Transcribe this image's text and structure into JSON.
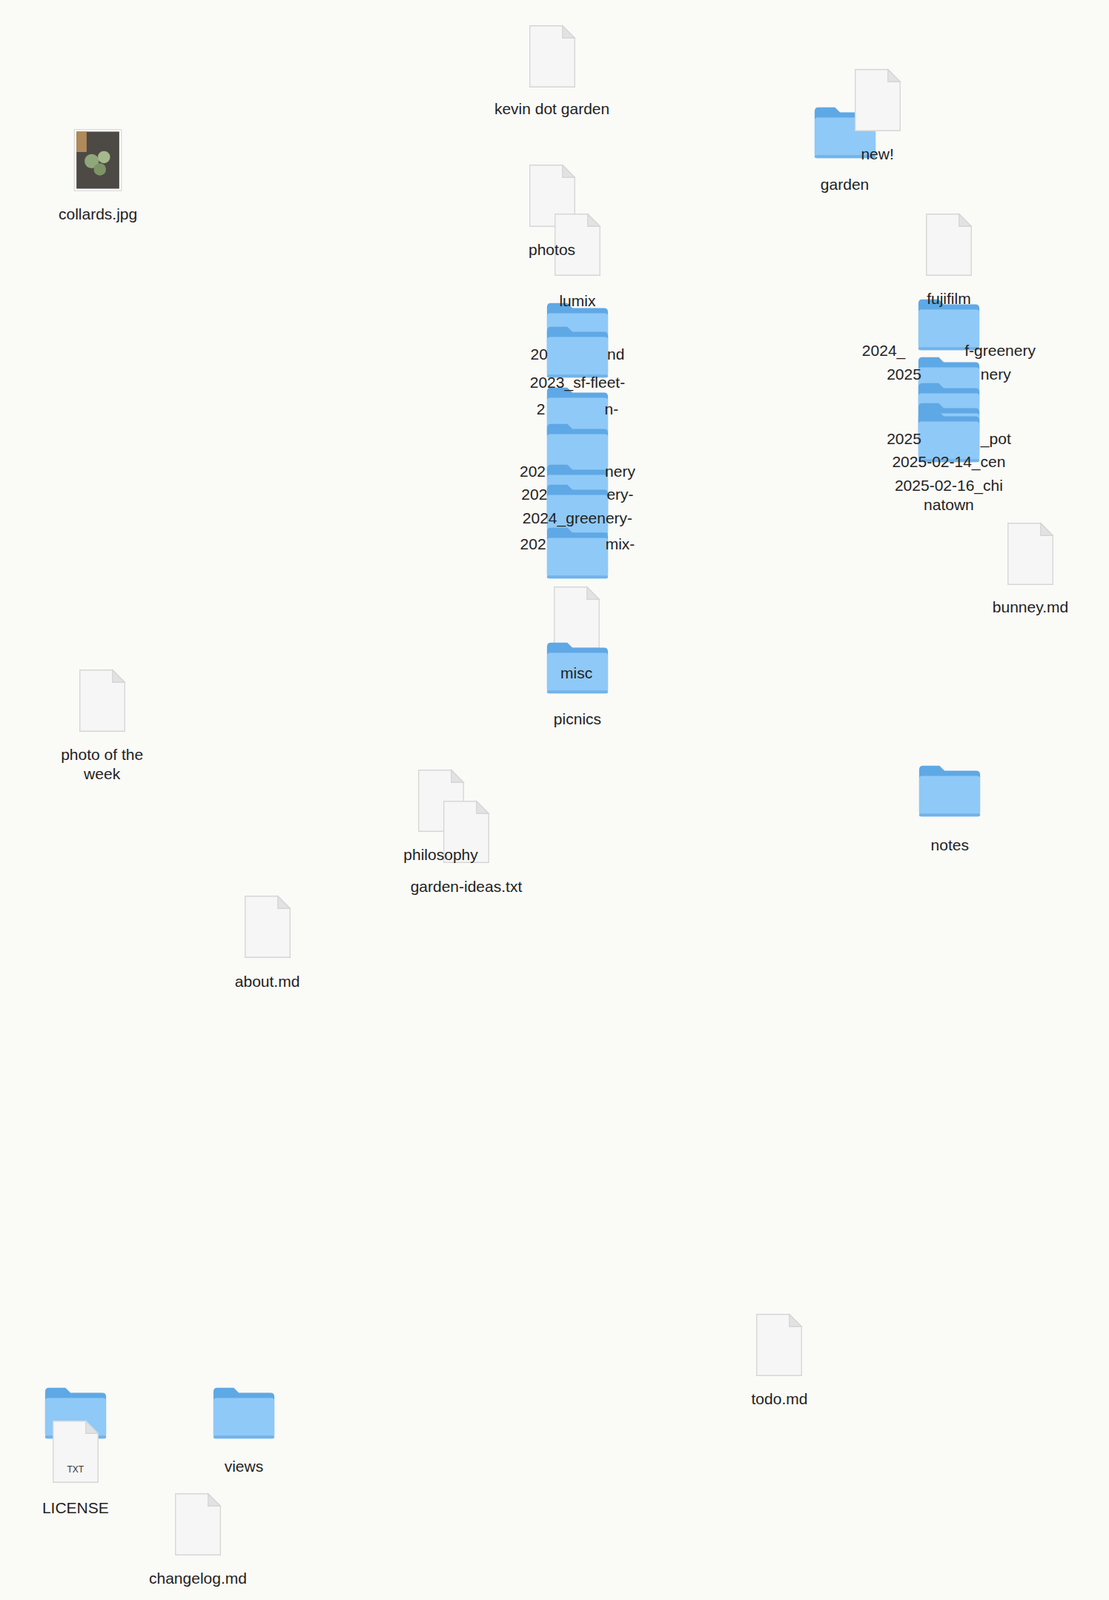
{
  "desktop": {
    "items": [
      {
        "kind": "file",
        "lines": [
          "kevin dot garden"
        ]
      },
      {
        "kind": "image",
        "lines": [
          "collards.jpg"
        ]
      },
      {
        "kind": "folder",
        "lines": [
          "garden"
        ]
      },
      {
        "kind": "file",
        "lines": [
          "new!"
        ]
      },
      {
        "kind": "file",
        "lines": [
          "photos"
        ]
      },
      {
        "kind": "file",
        "lines": [
          "lumix"
        ]
      },
      {
        "kind": "folder",
        "lines": [
          "20"
        ],
        "tail": "nd"
      },
      {
        "kind": "folder",
        "lines": [
          "2023_sf-fleet-"
        ]
      },
      {
        "kind": "folder",
        "lines": [
          "2"
        ],
        "tail": "n-"
      },
      {
        "kind": "folder",
        "lines": [
          "202"
        ],
        "tail": "nery"
      },
      {
        "kind": "folder",
        "lines": [
          "202"
        ],
        "tail": "ery-"
      },
      {
        "kind": "folder",
        "lines": [
          "2024_greenery-"
        ]
      },
      {
        "kind": "folder",
        "lines": [
          "202"
        ],
        "tail": "mix-"
      },
      {
        "kind": "file",
        "lines": [
          "fujifilm"
        ]
      },
      {
        "kind": "folder",
        "lines": [
          "2024_"
        ],
        "tail": "f-greenery"
      },
      {
        "kind": "folder",
        "lines": [
          "2025"
        ],
        "tail": "nery"
      },
      {
        "kind": "folder",
        "lines": [
          "2025"
        ],
        "tail": "_pot"
      },
      {
        "kind": "folder",
        "lines": [
          "2025-02-14_cen"
        ]
      },
      {
        "kind": "folder",
        "lines": [
          "2025-02-16_chi",
          "natown"
        ]
      },
      {
        "kind": "file",
        "lines": [
          "bunney.md"
        ]
      },
      {
        "kind": "file",
        "lines": [
          "misc"
        ]
      },
      {
        "kind": "folder",
        "lines": [
          "picnics"
        ]
      },
      {
        "kind": "file",
        "lines": [
          "photo of the",
          "week"
        ]
      },
      {
        "kind": "file",
        "lines": [
          "philosophy"
        ]
      },
      {
        "kind": "file",
        "lines": [
          "garden-ideas.txt"
        ]
      },
      {
        "kind": "folder",
        "lines": [
          "notes"
        ]
      },
      {
        "kind": "file",
        "lines": [
          "about.md"
        ]
      },
      {
        "kind": "file",
        "lines": [
          "todo.md"
        ]
      },
      {
        "kind": "folder",
        "lines": []
      },
      {
        "kind": "txt",
        "lines": [
          "LICENSE"
        ],
        "badge": "TXT"
      },
      {
        "kind": "folder",
        "lines": [
          "views"
        ]
      },
      {
        "kind": "file",
        "lines": [
          "changelog.md"
        ]
      }
    ]
  }
}
